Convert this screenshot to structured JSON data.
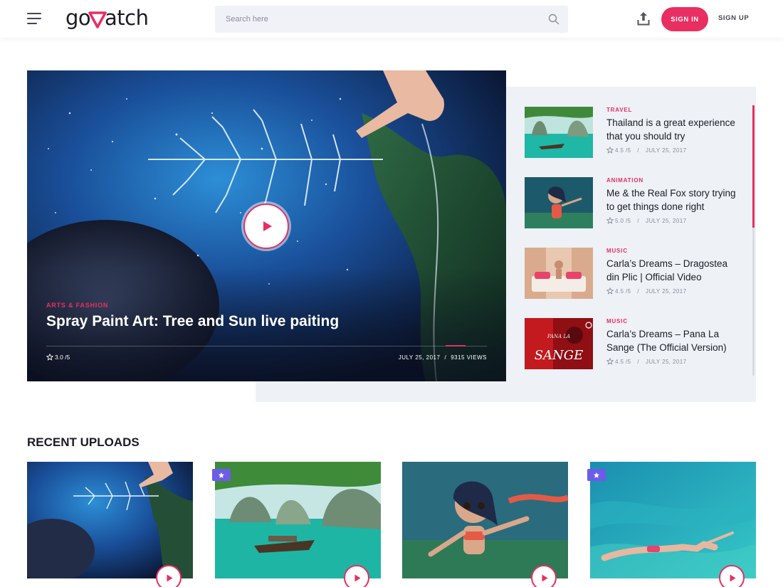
{
  "header": {
    "logo_text": "goWatch",
    "search_placeholder": "Search here",
    "signin_label": "SIGN IN",
    "signup_label": "SIGN UP"
  },
  "featured": {
    "category": "ARTS & FASHION",
    "title": "Spray Paint Art: Tree and Sun live paiting",
    "rating": "3.0 /5",
    "date": "JULY 25, 2017",
    "separator": "/",
    "views": "9315 VIEWS"
  },
  "side_list": [
    {
      "category": "TRAVEL",
      "title": "Thailand is a great experience that you should try",
      "rating": "4.5 /5",
      "date": "JULY 25, 2017"
    },
    {
      "category": "ANIMATION",
      "title": "Me & the Real Fox story trying to get things done right",
      "rating": "5.0 /5",
      "date": "JULY 25, 2017"
    },
    {
      "category": "MUSIC",
      "title": "Carla’s Dreams – Dragostea din Plic | Official Video",
      "rating": "4.5 /5",
      "date": "JULY 25, 2017"
    },
    {
      "category": "MUSIC",
      "title": "Carla’s Dreams – Pana La Sange (The Official Version)",
      "rating": "4.5 /5",
      "date": "JULY 25, 2017"
    }
  ],
  "side_separator": "/",
  "thumb_text": {
    "pana_la": "PANA LA",
    "sange": "SANGE"
  },
  "recent": {
    "heading": "RECENT UPLOADS",
    "cards": [
      {
        "featured": false
      },
      {
        "featured": true
      },
      {
        "featured": false
      },
      {
        "featured": true
      }
    ]
  },
  "colors": {
    "accent": "#e92e61",
    "badge": "#6c5ce7",
    "panel": "#eef1f6",
    "text": "#1b1c25"
  }
}
